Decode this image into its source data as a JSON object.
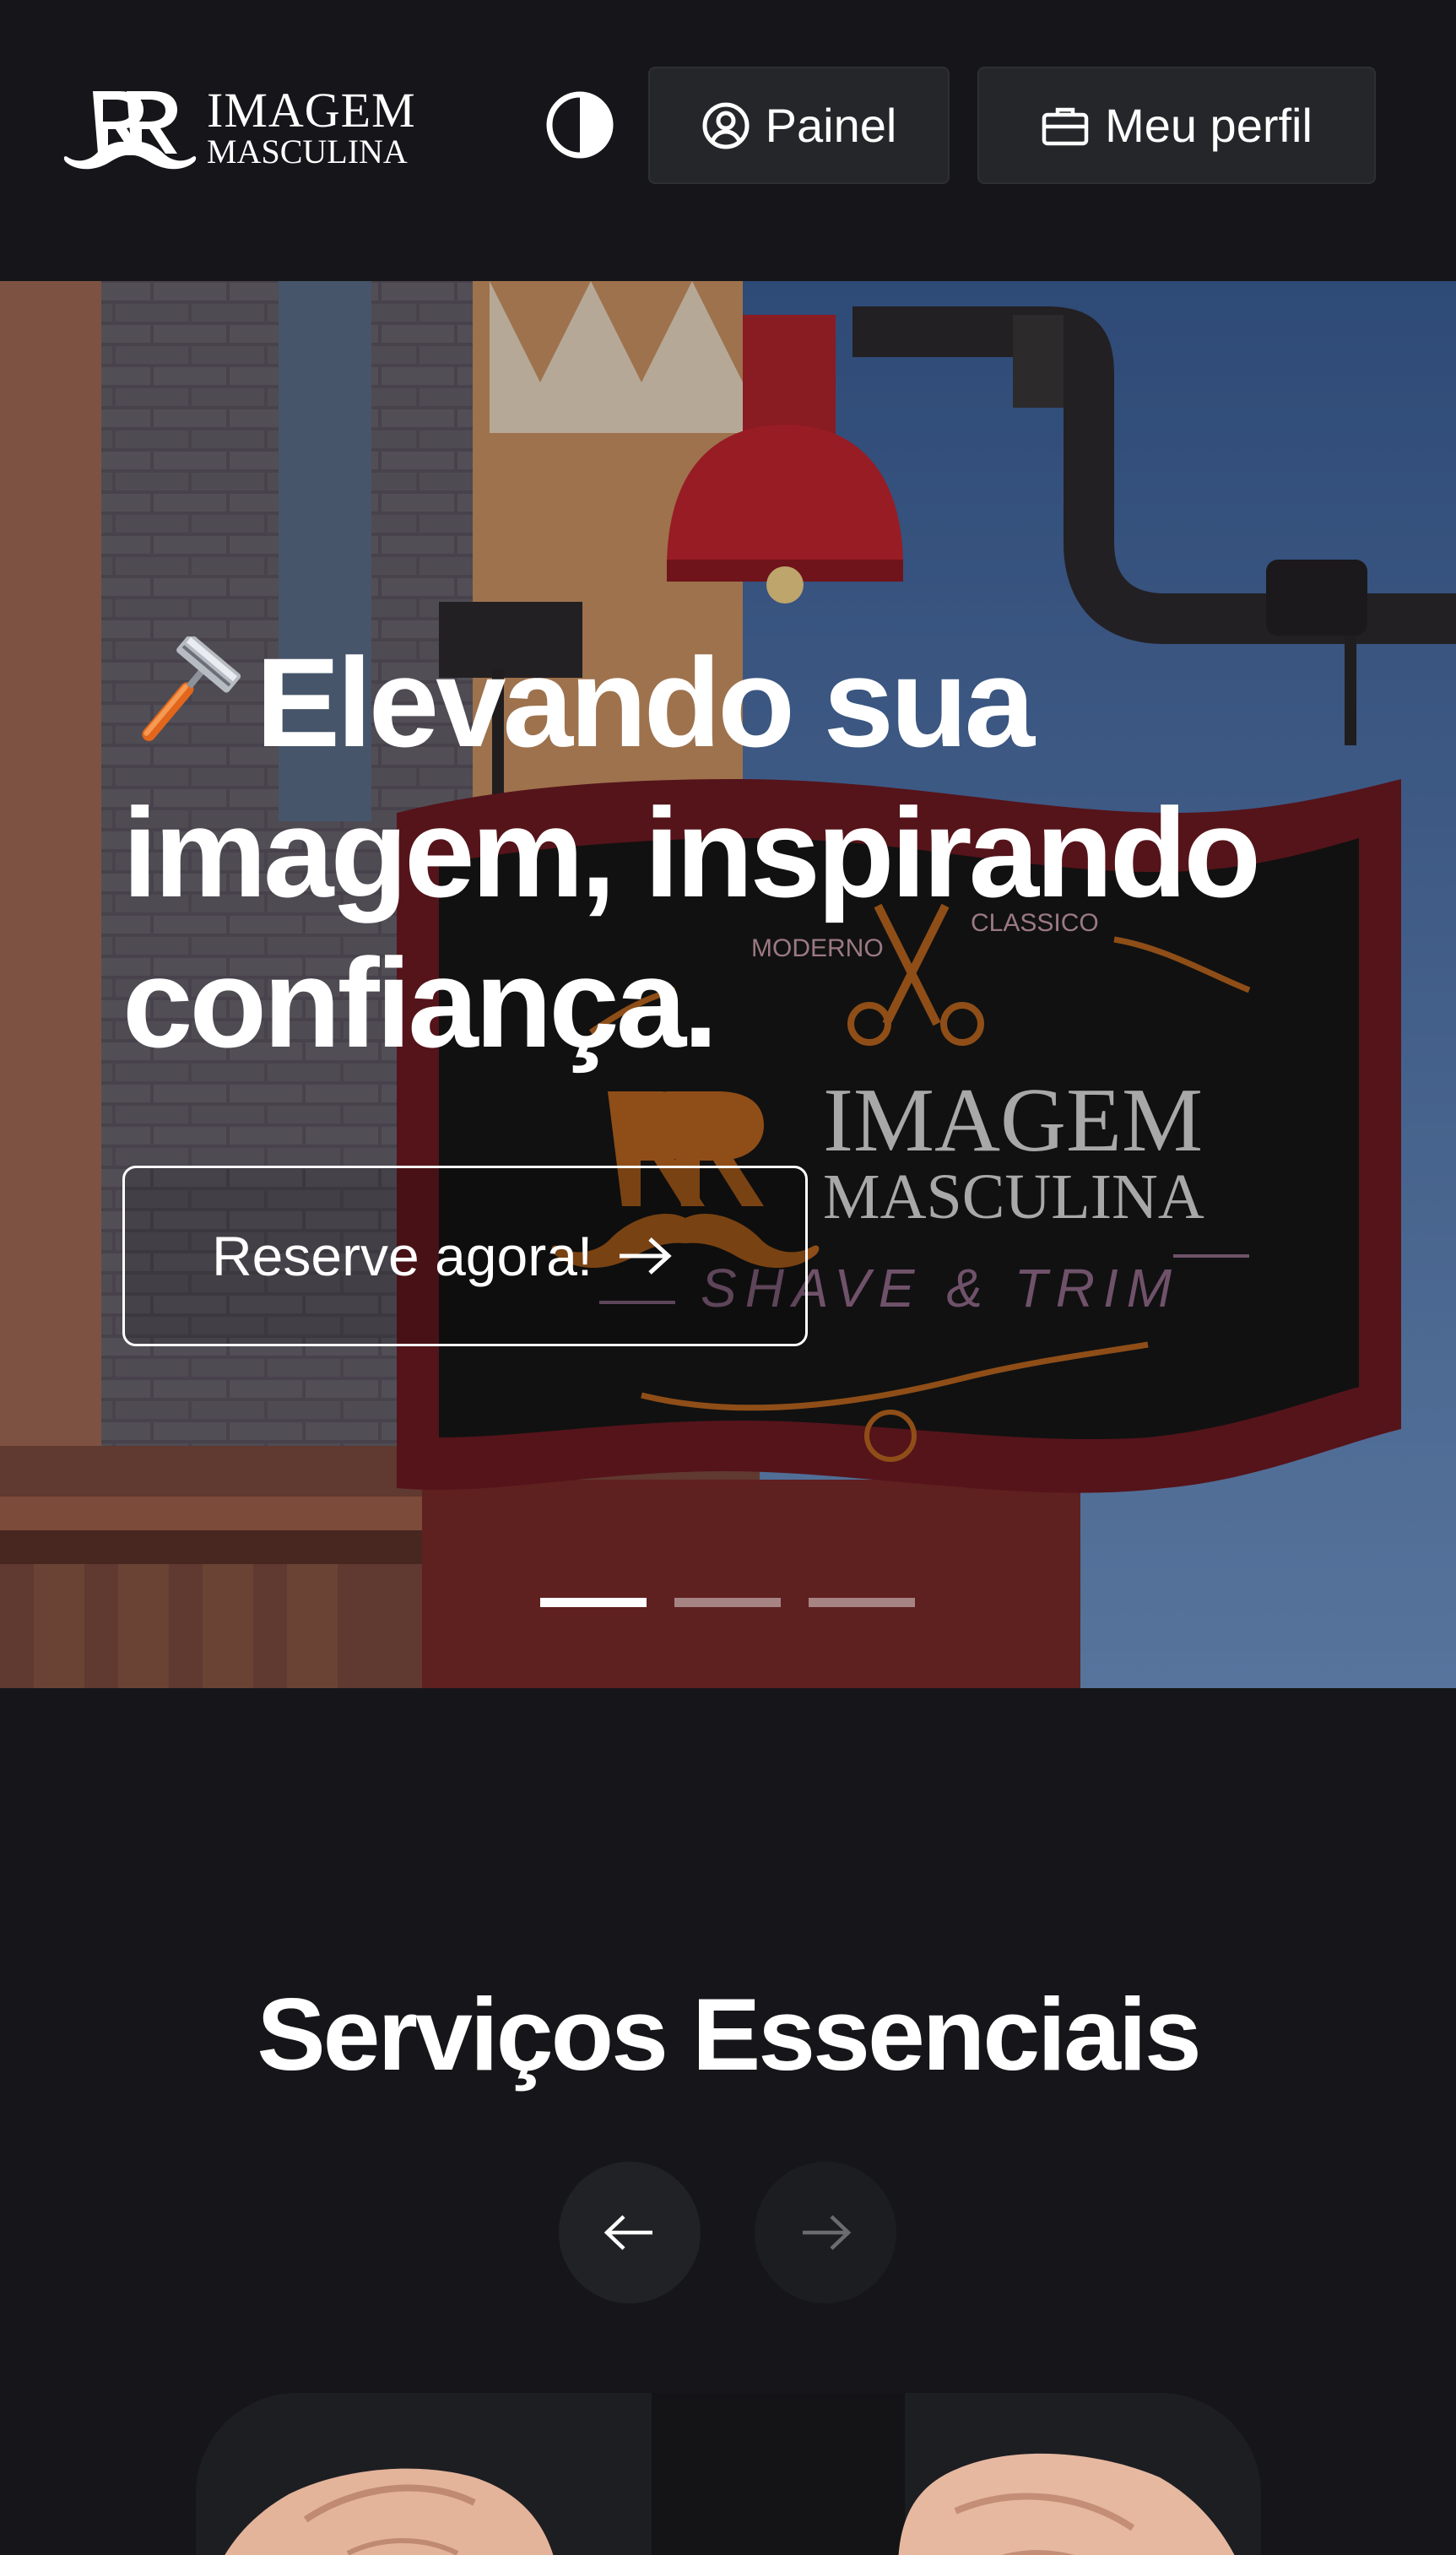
{
  "header": {
    "logo": {
      "line1": "IMAGEM",
      "line2": "MASCULINA",
      "icon": "mustache-rr-logo-icon"
    },
    "theme_toggle_icon": "contrast-icon",
    "painel": {
      "label": "Painel",
      "icon": "user-circle-icon"
    },
    "perfil": {
      "label": "Meu perfil",
      "icon": "briefcase-icon"
    }
  },
  "hero": {
    "title_emoji": "razor-icon",
    "title": "Elevando sua imagem, inspirando confiança.",
    "cta_label": "Reserve agora!",
    "cta_icon": "arrow-right-icon",
    "sign": {
      "left_word": "MODERNO",
      "right_word": "CLASSICO",
      "brand_line1": "IMAGEM",
      "brand_line2": "MASCULINA",
      "tagline": "SHAVE & TRIM"
    },
    "slides": 3,
    "active_slide": 1
  },
  "services": {
    "title": "Serviços Essenciais",
    "prev_icon": "arrow-left-icon",
    "next_icon": "arrow-right-icon"
  },
  "colors": {
    "background": "#16161a",
    "button": "#25262a",
    "accent_orange": "#b8651e",
    "sign_red": "#8a1c22",
    "sky": "#5b80b8"
  }
}
